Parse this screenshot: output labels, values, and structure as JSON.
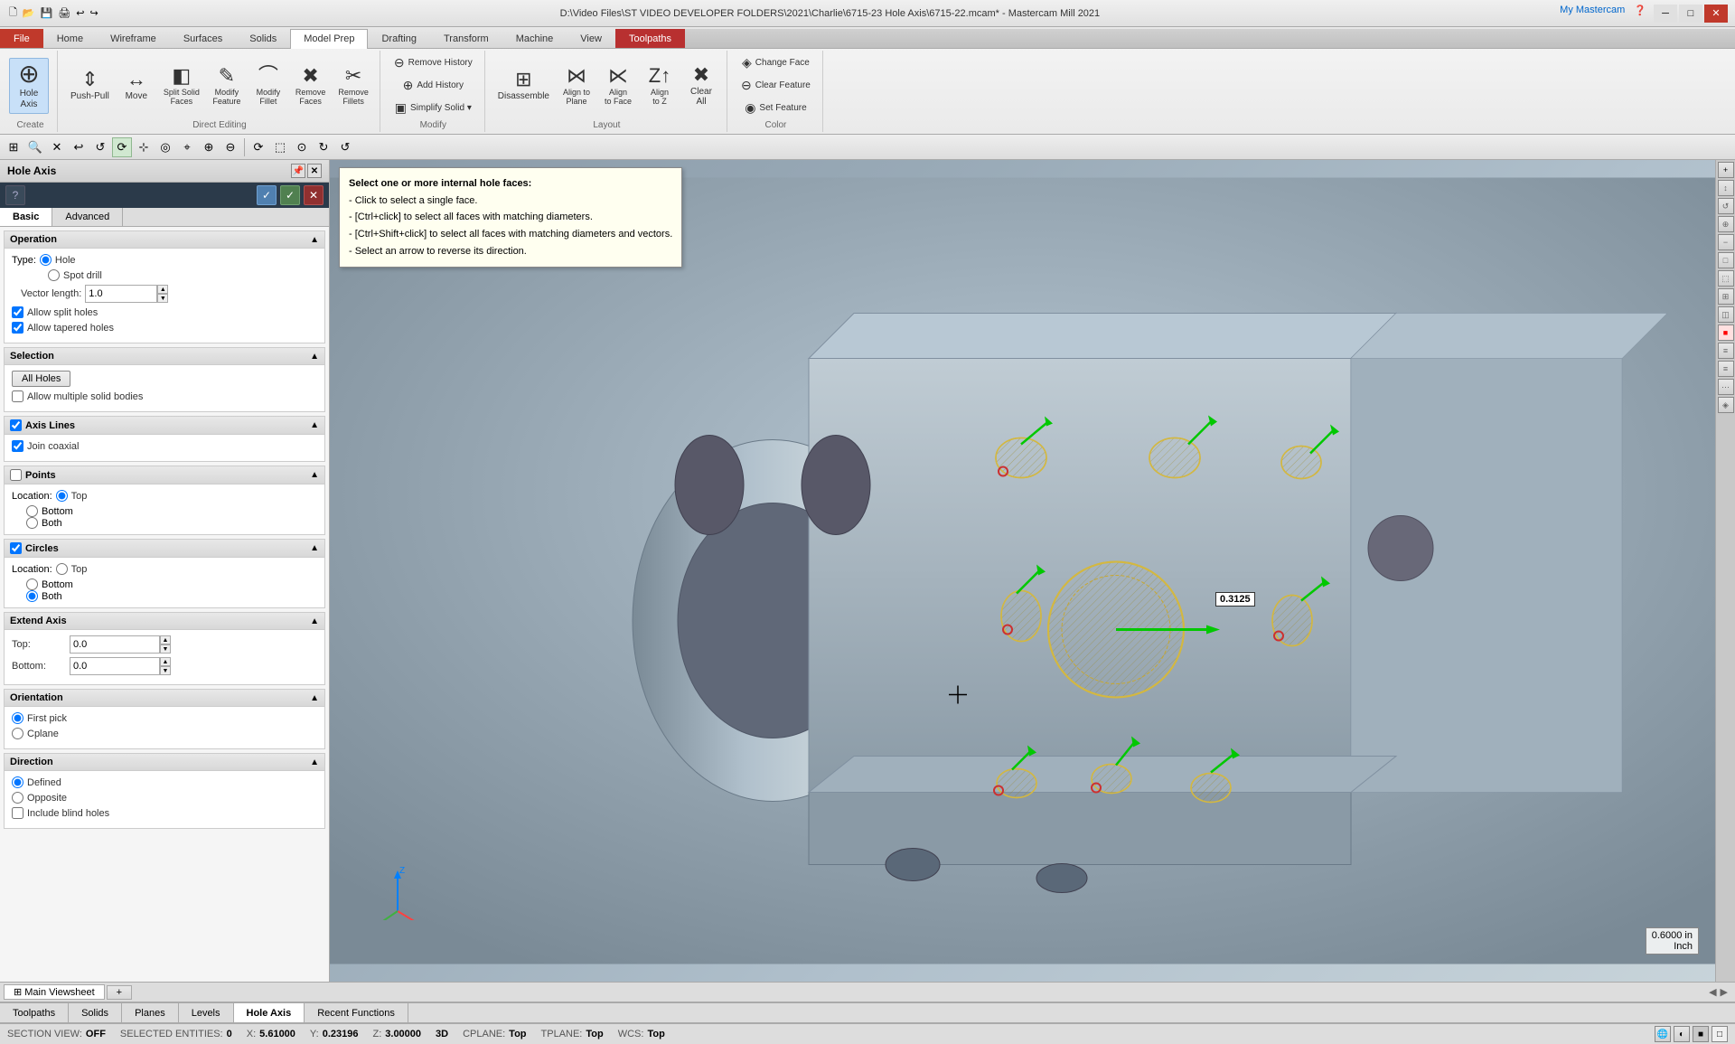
{
  "titlebar": {
    "title": "D:\\Video Files\\ST VIDEO DEVELOPER FOLDERS\\2021\\Charlie\\6715-23 Hole Axis\\6715-22.mcam* - Mastercam Mill 2021",
    "my_mastercam": "My Mastercam"
  },
  "ribbon": {
    "tabs": [
      "File",
      "Home",
      "Wireframe",
      "Surfaces",
      "Solids",
      "Model Prep",
      "Drafting",
      "Transform",
      "Machine",
      "View",
      "Toolpaths"
    ],
    "active_tab": "Model Prep",
    "highlight_tab": "Toolpaths",
    "groups": {
      "create": {
        "label": "Create",
        "buttons": [
          {
            "icon": "⊕",
            "label": "Hole\nAxis"
          }
        ]
      },
      "direct_editing": {
        "label": "Direct Editing",
        "buttons": [
          {
            "icon": "↷",
            "label": "Push-Pull"
          },
          {
            "icon": "↔",
            "label": "Move"
          },
          {
            "icon": "◧",
            "label": "Split Solid\nFaces"
          },
          {
            "icon": "✎",
            "label": "Modify\nFeature"
          },
          {
            "icon": "⌒",
            "label": "Modify\nFillet"
          },
          {
            "icon": "✖",
            "label": "Remove\nFaces"
          },
          {
            "icon": "✂",
            "label": "Remove\nFillets"
          }
        ]
      },
      "modify": {
        "label": "Modify",
        "small_buttons": [
          {
            "icon": "⊖",
            "label": "Remove History"
          },
          {
            "icon": "⊕",
            "label": "Add History"
          },
          {
            "icon": "▣",
            "label": "Simplify Solid ▾"
          }
        ]
      },
      "layout": {
        "label": "Layout",
        "buttons": [
          {
            "icon": "⊞",
            "label": "Disassemble"
          },
          {
            "icon": "⋈",
            "label": "Align to\nPlane"
          },
          {
            "icon": "⋉",
            "label": "Align\nto Face"
          },
          {
            "icon": "Z↑",
            "label": "Align\nto Z"
          },
          {
            "icon": "✖",
            "label": "Clear\nAll"
          }
        ]
      },
      "color": {
        "label": "Color",
        "small_buttons": [
          {
            "icon": "◈",
            "label": "Change Face"
          },
          {
            "icon": "⊖",
            "label": "Clear Feature"
          },
          {
            "icon": "◉",
            "label": "Set Feature"
          }
        ]
      }
    }
  },
  "panel": {
    "title": "Hole Axis",
    "tabs": [
      "Basic",
      "Advanced"
    ],
    "active_tab": "Basic",
    "sections": {
      "operation": {
        "label": "Operation",
        "type_options": [
          "Hole",
          "Spot drill"
        ],
        "type_selected": "Hole",
        "vector_length": {
          "label": "Vector length:",
          "value": "1.0"
        },
        "checkboxes": [
          {
            "label": "Allow split holes",
            "checked": true
          },
          {
            "label": "Allow tapered holes",
            "checked": true
          }
        ]
      },
      "selection": {
        "label": "Selection",
        "all_holes_btn": "All Holes",
        "checkboxes": [
          {
            "label": "Allow multiple solid bodies",
            "checked": false
          }
        ]
      },
      "axis_lines": {
        "label": "Axis Lines",
        "checked": true,
        "checkboxes": [
          {
            "label": "Join coaxial",
            "checked": true
          }
        ]
      },
      "points": {
        "label": "Points",
        "checked": false,
        "location_options": [
          "Top",
          "Bottom",
          "Both"
        ],
        "location_selected": "Top"
      },
      "circles": {
        "label": "Circles",
        "checked": true,
        "location_options": [
          "Top",
          "Bottom",
          "Both"
        ],
        "location_selected": "Both"
      },
      "extend_axis": {
        "label": "Extend Axis",
        "top": {
          "label": "Top:",
          "value": "0.0"
        },
        "bottom": {
          "label": "Bottom:",
          "value": "0.0"
        }
      },
      "orientation": {
        "label": "Orientation",
        "options": [
          "First pick",
          "Cplane"
        ],
        "selected": "First pick"
      },
      "direction": {
        "label": "Direction",
        "options": [
          "Defined",
          "Opposite"
        ],
        "selected": "Defined",
        "checkboxes": [
          {
            "label": "Include blind holes",
            "checked": false
          }
        ]
      }
    }
  },
  "tooltip": {
    "lines": [
      "Select one or more internal hole faces:",
      "- Click to select a single face.",
      "- [Ctrl+click] to select all faces with matching diameters.",
      "- [Ctrl+Shift+click] to select all faces with matching diameters and vectors.",
      "- Select an arrow to reverse its direction."
    ]
  },
  "viewport": {
    "dim_label": "0.3125",
    "coord_label": "0.6000 in\nInch"
  },
  "viewport_toolbar": {
    "buttons": [
      "⊞",
      "🔍",
      "⊠",
      "↩",
      "↺",
      "⟳",
      "⊹",
      "◎",
      "⌖",
      "⊕",
      "⊖",
      "⤢",
      "⟳",
      "⬚",
      "⊙"
    ]
  },
  "viewsheet_tabs": [
    {
      "label": "Main Viewsheet",
      "active": true
    },
    {
      "label": "+"
    }
  ],
  "bottom_tabs": [
    "Toolpaths",
    "Solids",
    "Planes",
    "Levels",
    "Hole Axis",
    "Recent Functions"
  ],
  "active_bottom_tab": "Hole Axis",
  "status_bar": {
    "section_view": {
      "label": "SECTION VIEW:",
      "value": "OFF"
    },
    "selected_entities": {
      "label": "SELECTED ENTITIES:",
      "value": "0"
    },
    "x": {
      "label": "X:",
      "value": "5.61000"
    },
    "y": {
      "label": "Y:",
      "value": "0.23196"
    },
    "z": {
      "label": "Z:",
      "value": "3.00000"
    },
    "mode": {
      "value": "3D"
    },
    "cplane": {
      "label": "CPLANE:",
      "value": "Top"
    },
    "tplane": {
      "label": "TPLANE:",
      "value": "Top"
    },
    "wcs": {
      "label": "WCS:",
      "value": "Top"
    }
  }
}
